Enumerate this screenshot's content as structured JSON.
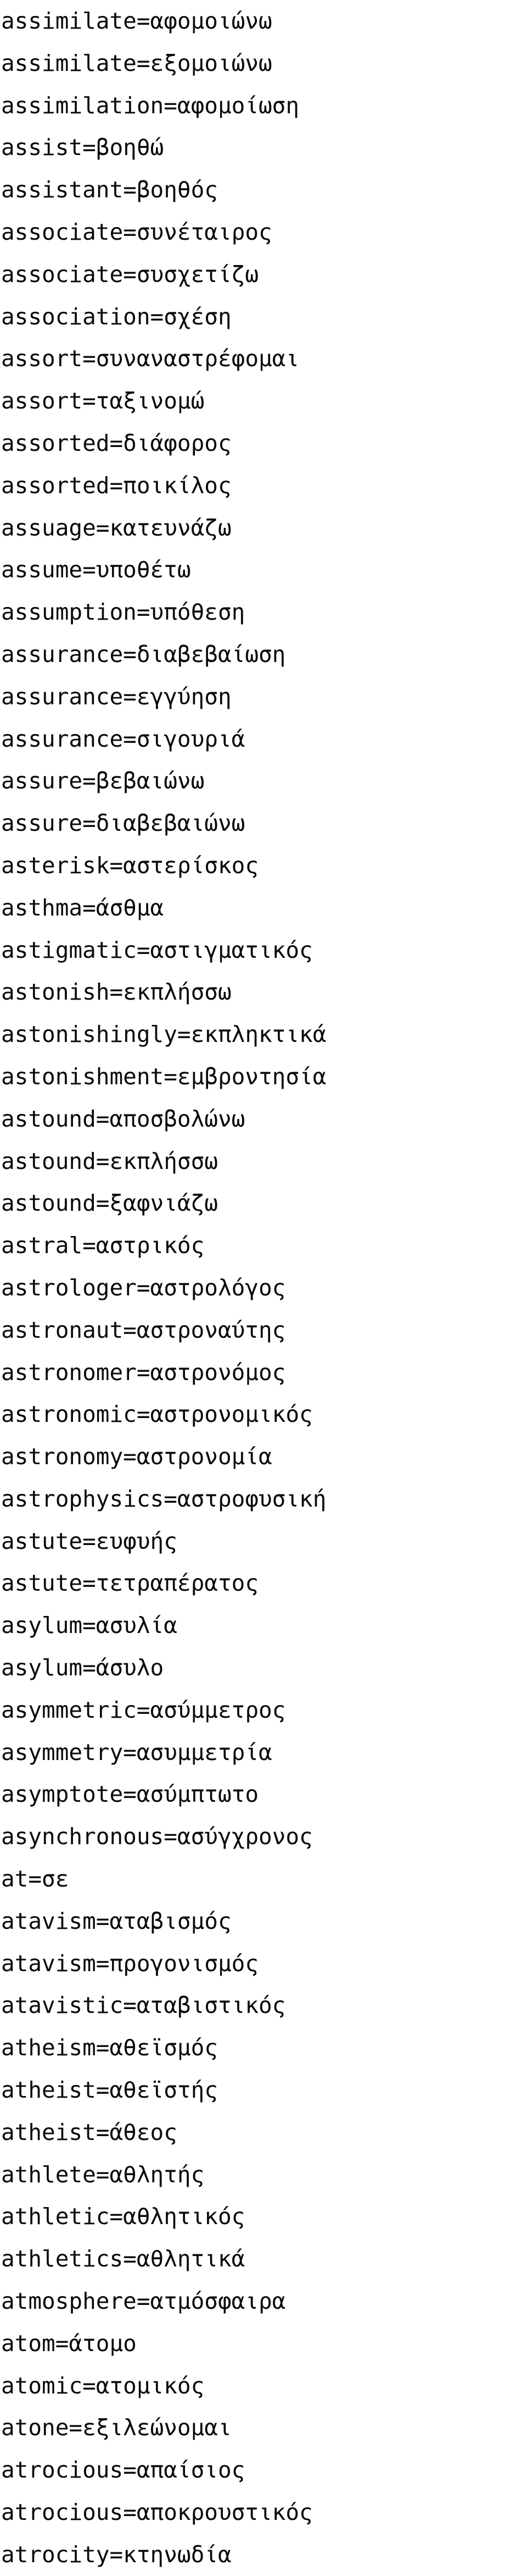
{
  "document": {
    "kind": "dictionary-word-list",
    "direction": "english-to-greek",
    "separator": "=",
    "background_color": "#ffffff",
    "text_color": "#0a0a0a",
    "line_count": 60
  },
  "entries": [
    {
      "term": "assimilate",
      "translation": "αφομοιώνω",
      "line": "assimilate=αφομοιώνω"
    },
    {
      "term": "assimilate",
      "translation": "εξομοιώνω",
      "line": "assimilate=εξομοιώνω"
    },
    {
      "term": "assimilation",
      "translation": "αφομοίωση",
      "line": "assimilation=αφομοίωση"
    },
    {
      "term": "assist",
      "translation": "βοηθώ",
      "line": "assist=βοηθώ"
    },
    {
      "term": "assistant",
      "translation": "βοηθός",
      "line": "assistant=βοηθός"
    },
    {
      "term": "associate",
      "translation": "συνέταιρος",
      "line": "associate=συνέταιρος"
    },
    {
      "term": "associate",
      "translation": "συσχετίζω",
      "line": "associate=συσχετίζω"
    },
    {
      "term": "association",
      "translation": "σχέση",
      "line": "association=σχέση"
    },
    {
      "term": "assort",
      "translation": "συναναστρέφομαι",
      "line": "assort=συναναστρέφομαι"
    },
    {
      "term": "assort",
      "translation": "ταξινομώ",
      "line": "assort=ταξινομώ"
    },
    {
      "term": "assorted",
      "translation": "διάφορος",
      "line": "assorted=διάφορος"
    },
    {
      "term": "assorted",
      "translation": "ποικίλος",
      "line": "assorted=ποικίλος"
    },
    {
      "term": "assuage",
      "translation": "κατευνάζω",
      "line": "assuage=κατευνάζω"
    },
    {
      "term": "assume",
      "translation": "υποθέτω",
      "line": "assume=υποθέτω"
    },
    {
      "term": "assumption",
      "translation": "υπόθεση",
      "line": "assumption=υπόθεση"
    },
    {
      "term": "assurance",
      "translation": "διαβεβαίωση",
      "line": "assurance=διαβεβαίωση"
    },
    {
      "term": "assurance",
      "translation": "εγγύηση",
      "line": "assurance=εγγύηση"
    },
    {
      "term": "assurance",
      "translation": "σιγουριά",
      "line": "assurance=σιγουριά"
    },
    {
      "term": "assure",
      "translation": "βεβαιώνω",
      "line": "assure=βεβαιώνω"
    },
    {
      "term": "assure",
      "translation": "διαβεβαιώνω",
      "line": "assure=διαβεβαιώνω"
    },
    {
      "term": "asterisk",
      "translation": "αστερίσκος",
      "line": "asterisk=αστερίσκος"
    },
    {
      "term": "asthma",
      "translation": "άσθμα",
      "line": "asthma=άσθμα"
    },
    {
      "term": "astigmatic",
      "translation": "αστιγματικός",
      "line": "astigmatic=αστιγματικός"
    },
    {
      "term": "astonish",
      "translation": "εκπλήσσω",
      "line": "astonish=εκπλήσσω"
    },
    {
      "term": "astonishingly",
      "translation": "εκπληκτικά",
      "line": "astonishingly=εκπληκτικά"
    },
    {
      "term": "astonishment",
      "translation": "εμβροντησία",
      "line": "astonishment=εμβροντησία"
    },
    {
      "term": "astound",
      "translation": "αποσβολώνω",
      "line": "astound=αποσβολώνω"
    },
    {
      "term": "astound",
      "translation": "εκπλήσσω",
      "line": "astound=εκπλήσσω"
    },
    {
      "term": "astound",
      "translation": "ξαφνιάζω",
      "line": "astound=ξαφνιάζω"
    },
    {
      "term": "astral",
      "translation": "αστρικός",
      "line": "astral=αστρικός"
    },
    {
      "term": "astrologer",
      "translation": "αστρολόγος",
      "line": "astrologer=αστρολόγος"
    },
    {
      "term": "astronaut",
      "translation": "αστροναύτης",
      "line": "astronaut=αστροναύτης"
    },
    {
      "term": "astronomer",
      "translation": "αστρονόμος",
      "line": "astronomer=αστρονόμος"
    },
    {
      "term": "astronomic",
      "translation": "αστρονομικός",
      "line": "astronomic=αστρονομικός"
    },
    {
      "term": "astronomy",
      "translation": "αστρονομία",
      "line": "astronomy=αστρονομία"
    },
    {
      "term": "astrophysics",
      "translation": "αστροφυσική",
      "line": "astrophysics=αστροφυσική"
    },
    {
      "term": "astute",
      "translation": "ευφυής",
      "line": "astute=ευφυής"
    },
    {
      "term": "astute",
      "translation": "τετραπέρατος",
      "line": "astute=τετραπέρατος"
    },
    {
      "term": "asylum",
      "translation": "ασυλία",
      "line": "asylum=ασυλία"
    },
    {
      "term": "asylum",
      "translation": "άσυλο",
      "line": "asylum=άσυλο"
    },
    {
      "term": "asymmetric",
      "translation": "ασύμμετρος",
      "line": "asymmetric=ασύμμετρος"
    },
    {
      "term": "asymmetry",
      "translation": "ασυμμετρία",
      "line": "asymmetry=ασυμμετρία"
    },
    {
      "term": "asymptote",
      "translation": "ασύμπτωτο",
      "line": "asymptote=ασύμπτωτο"
    },
    {
      "term": "asynchronous",
      "translation": "ασύγχρονος",
      "line": "asynchronous=ασύγχρονος"
    },
    {
      "term": "at",
      "translation": "σε",
      "line": "at=σε"
    },
    {
      "term": "atavism",
      "translation": "αταβισμός",
      "line": "atavism=αταβισμός"
    },
    {
      "term": "atavism",
      "translation": "προγονισμός",
      "line": "atavism=προγονισμός"
    },
    {
      "term": "atavistic",
      "translation": "αταβιστικός",
      "line": "atavistic=αταβιστικός"
    },
    {
      "term": "atheism",
      "translation": "αθεϊσμός",
      "line": "atheism=αθεϊσμός"
    },
    {
      "term": "atheist",
      "translation": "αθεϊστής",
      "line": "atheist=αθεϊστής"
    },
    {
      "term": "atheist",
      "translation": "άθεος",
      "line": "atheist=άθεος"
    },
    {
      "term": "athlete",
      "translation": "αθλητής",
      "line": "athlete=αθλητής"
    },
    {
      "term": "athletic",
      "translation": "αθλητικός",
      "line": "athletic=αθλητικός"
    },
    {
      "term": "athletics",
      "translation": "αθλητικά",
      "line": "athletics=αθλητικά"
    },
    {
      "term": "atmosphere",
      "translation": "ατμόσφαιρα",
      "line": "atmosphere=ατμόσφαιρα"
    },
    {
      "term": "atom",
      "translation": "άτομο",
      "line": "atom=άτομο"
    },
    {
      "term": "atomic",
      "translation": "ατομικός",
      "line": "atomic=ατομικός"
    },
    {
      "term": "atone",
      "translation": "εξιλεώνομαι",
      "line": "atone=εξιλεώνομαι"
    },
    {
      "term": "atrocious",
      "translation": "απαίσιος",
      "line": "atrocious=απαίσιος"
    },
    {
      "term": "atrocious",
      "translation": "αποκρουστικός",
      "line": "atrocious=αποκρουστικός"
    },
    {
      "term": "atrocity",
      "translation": "κτηνωδία",
      "line": "atrocity=κτηνωδία"
    }
  ]
}
